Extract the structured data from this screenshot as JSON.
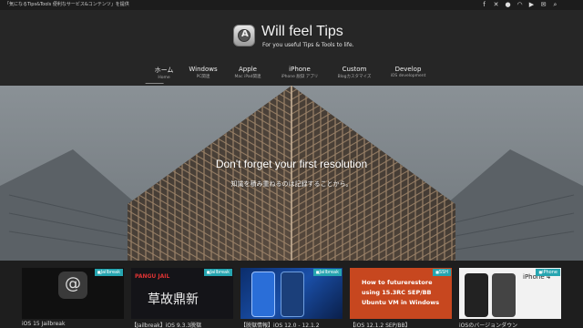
{
  "topbar": {
    "tagline": "「気になるTips&Tools 便利なサービス&コンテンツ」を提供",
    "social_icons": [
      "facebook-icon",
      "x-icon",
      "github-icon",
      "rss-icon",
      "youtube-icon",
      "mail-icon",
      "search-icon"
    ]
  },
  "site": {
    "title": "Will feel Tips",
    "subtitle": "For you useful Tips & Tools to life."
  },
  "nav": [
    {
      "label": "ホーム",
      "sub": "Home"
    },
    {
      "label": "Windows",
      "sub": "PC関連"
    },
    {
      "label": "Apple",
      "sub": "Mac iPad関連"
    },
    {
      "label": "iPhone",
      "sub": "iPhone 脱獄 アプリ"
    },
    {
      "label": "Custom",
      "sub": "Blogカスタマイズ"
    },
    {
      "label": "Develop",
      "sub": "iOS development"
    }
  ],
  "hero": {
    "title": "Don't forget your first resolution",
    "subtitle": "知識を積み重ねるのは記録することから。"
  },
  "cards": [
    {
      "category": "Jailbreak",
      "image_text": "",
      "title": "iOS 15 Jailbreak"
    },
    {
      "category": "Jailbreak",
      "image_text": "PANGU JAIL",
      "image_text2": "草故鼎新",
      "title": "【Jailbreak】iOS 9.3.3脱獄"
    },
    {
      "category": "Jailbreak",
      "image_text": "",
      "title": "【脱獄情報】iOS 12.0 - 12.1.2"
    },
    {
      "category": "SSH",
      "image_text": "How to futurerestore using 15.3RC SEP/BB Ubuntu VM in Windows",
      "title": "【iOS 12.1.2 SEP/BB】"
    },
    {
      "category": "iPhone",
      "image_text": "iPhone 4",
      "title": "iOSのバージョンダウン"
    }
  ],
  "colors": {
    "topbar": "#1c1c1c",
    "header": "#262626",
    "category_badge": "#26a5b0"
  }
}
